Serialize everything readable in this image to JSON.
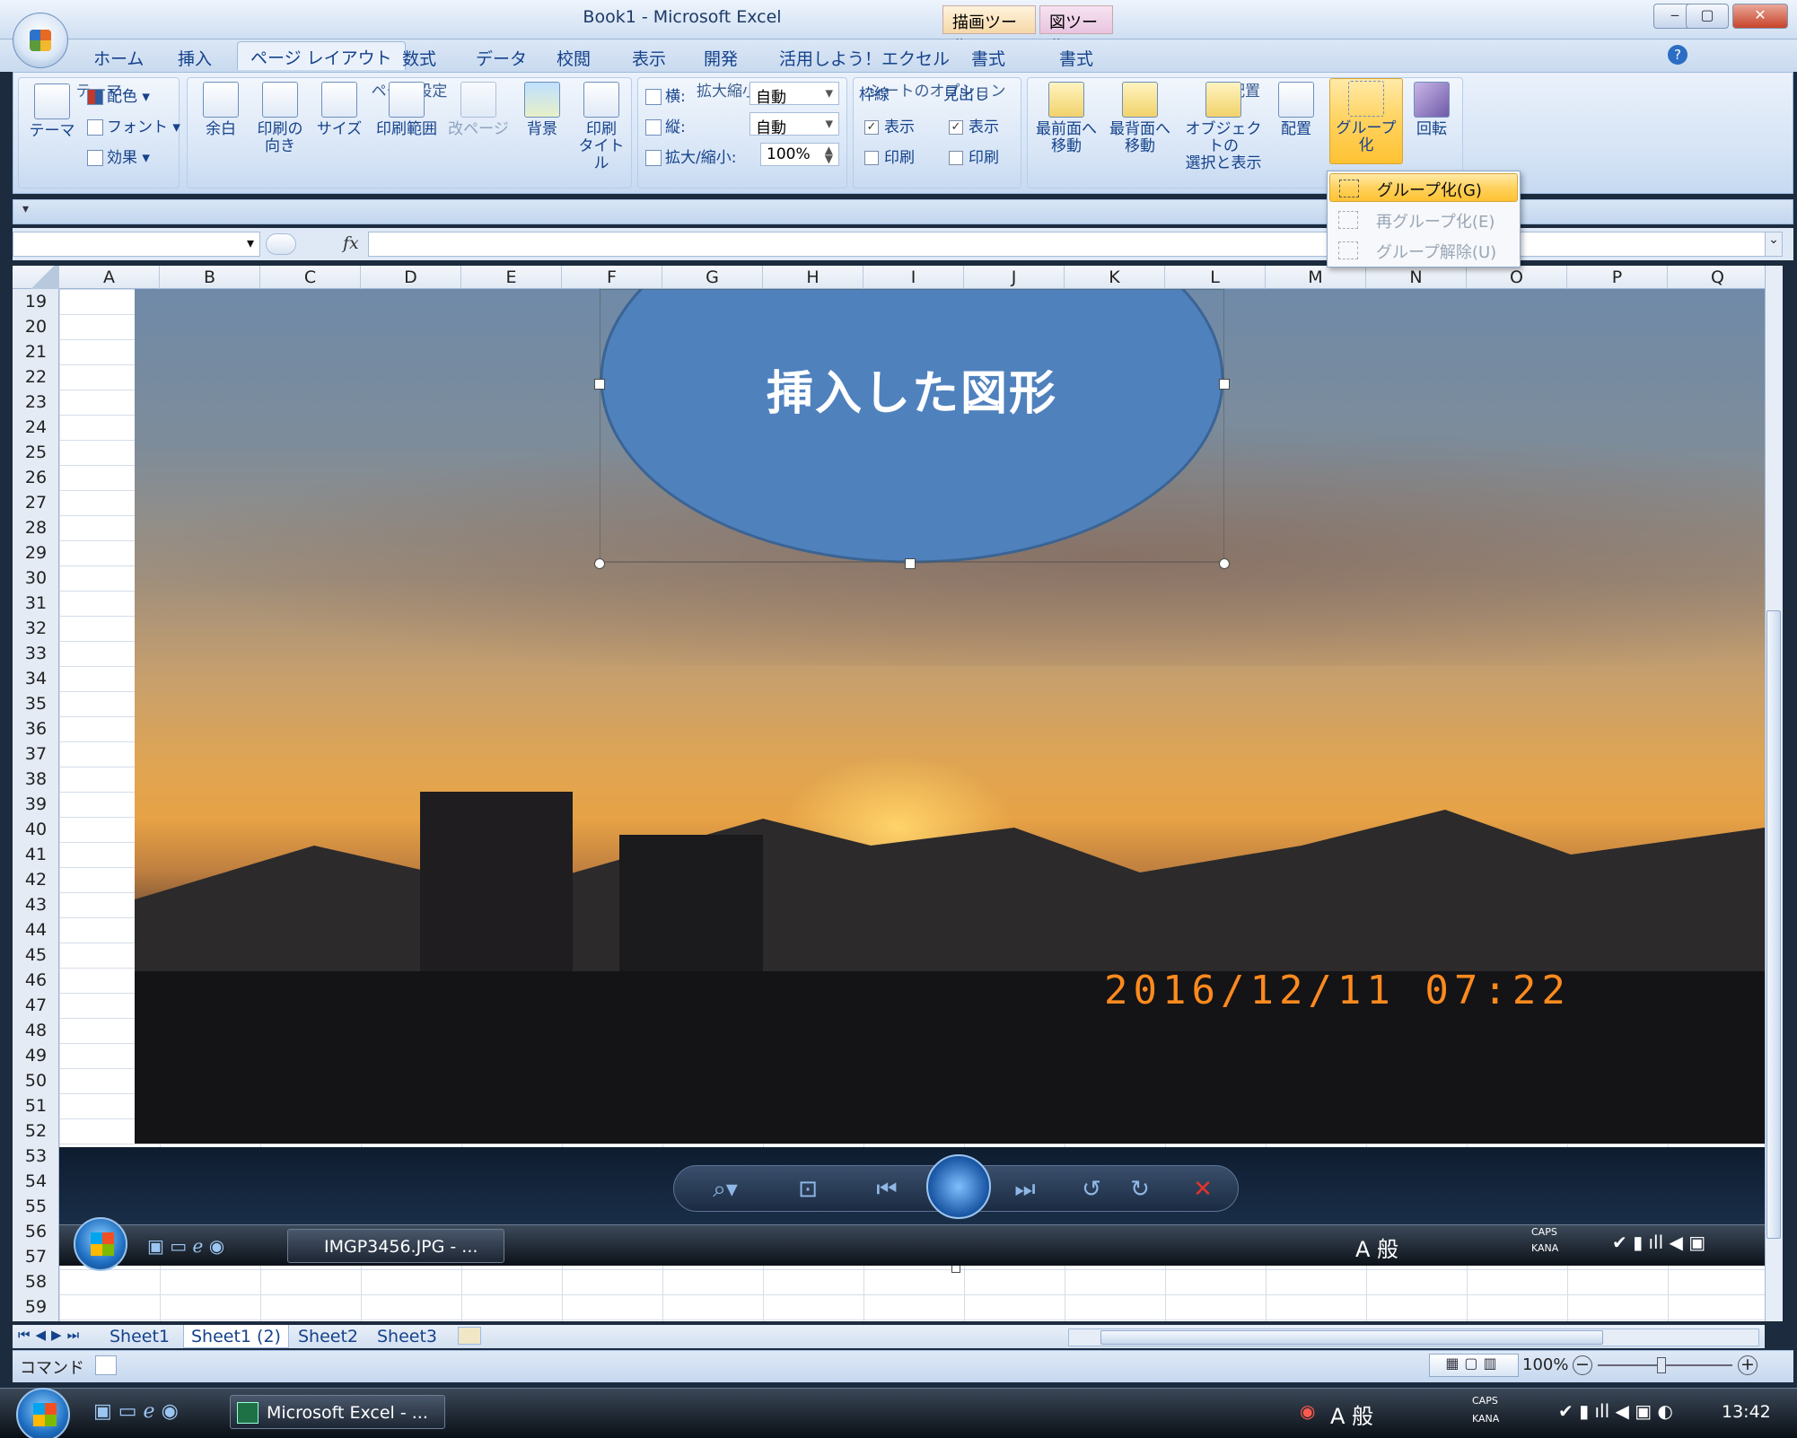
{
  "window": {
    "title": "Book1 - Microsoft Excel",
    "context_draw": "描画ツール",
    "context_picture": "図ツール",
    "controls": [
      "‒",
      "▢",
      "✕"
    ]
  },
  "tabs": [
    "ホーム",
    "挿入",
    "ページ レイアウト",
    "数式",
    "データ",
    "校閲",
    "表示",
    "開発",
    "活用しよう！エクセル",
    "書式",
    "書式"
  ],
  "active_tab": "ページ レイアウト",
  "ribbon": {
    "theme": {
      "big": "テーマ",
      "colors": "配色",
      "fonts": "フォント",
      "effects": "効果",
      "label": "テーマ"
    },
    "page_setup": {
      "margins": "余白",
      "orientation": "印刷の\n向き",
      "size": "サイズ",
      "print_area": "印刷範囲",
      "breaks": "改ページ",
      "background": "背景",
      "print_titles": "印刷\nタイトル",
      "label": "ページ設定"
    },
    "scale": {
      "width_label": "横:",
      "width_value": "自動",
      "height_label": "縦:",
      "height_value": "自動",
      "scale_label": "拡大/縮小:",
      "scale_value": "100%",
      "label": "拡大縮小印刷"
    },
    "sheet_options": {
      "gridlines": "枠線",
      "headings": "見出し",
      "view": "表示",
      "print": "印刷",
      "label": "シートのオプション"
    },
    "arrange": {
      "bring_front": "最前面へ\n移動",
      "send_back": "最背面へ\n移動",
      "selection_pane": "オブジェクトの\n選択と表示",
      "align": "配置",
      "group": "グループ化",
      "rotate": "回転",
      "label": "配置"
    }
  },
  "group_menu": {
    "items": [
      {
        "label": "グループ化(G)",
        "enabled": true
      },
      {
        "label": "再グループ化(E)",
        "enabled": false
      },
      {
        "label": "グループ解除(U)",
        "enabled": false
      }
    ]
  },
  "formula": {
    "fx": "fx",
    "value": ""
  },
  "columns": [
    "A",
    "B",
    "C",
    "D",
    "E",
    "F",
    "G",
    "H",
    "I",
    "J",
    "K",
    "L",
    "M",
    "N",
    "O",
    "P",
    "Q"
  ],
  "rows": [
    "19",
    "20",
    "21",
    "22",
    "23",
    "24",
    "25",
    "26",
    "27",
    "28",
    "29",
    "30",
    "31",
    "32",
    "33",
    "34",
    "35",
    "36",
    "37",
    "38",
    "39",
    "40",
    "41",
    "42",
    "43",
    "44",
    "45",
    "46",
    "47",
    "48",
    "49",
    "50",
    "51",
    "52",
    "53",
    "54",
    "55",
    "56",
    "57",
    "58",
    "59"
  ],
  "shape": {
    "text": "挿入した図形",
    "fill": "#4f81bd"
  },
  "photo": {
    "timestamp": "2016/12/11  07:22"
  },
  "inner_taskbar": {
    "window_button": "IMGP3456.JPG - ...",
    "ime": "A 般",
    "caps": "CAPS",
    "kana": "KANA"
  },
  "sheets": [
    "Sheet1",
    "Sheet1 (2)",
    "Sheet2",
    "Sheet3"
  ],
  "active_sheet": "Sheet1 (2)",
  "status": {
    "mode": "コマンド",
    "zoom": "100%"
  },
  "taskbar": {
    "window_button": "Microsoft Excel - ...",
    "ime": "A 般",
    "caps": "CAPS",
    "kana": "KANA",
    "clock": "13:42"
  }
}
